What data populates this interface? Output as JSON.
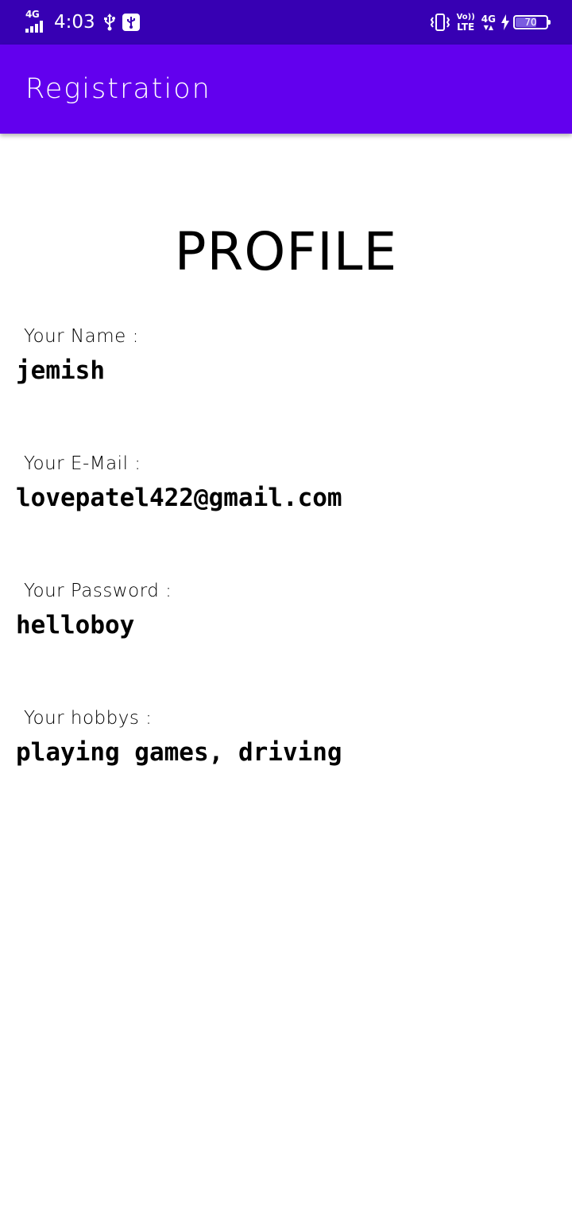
{
  "status_bar": {
    "network_label": "4G",
    "time": "4:03",
    "volte_top": "Vo))",
    "volte_bottom": "LTE",
    "data_network": "4G",
    "battery_level": "70",
    "battery_fraction": 0.7,
    "icons": [
      "signal-icon",
      "usb-icon",
      "usb-debug-icon",
      "vibrate-icon",
      "charging-icon",
      "battery-icon"
    ]
  },
  "app_bar": {
    "title": "Registration",
    "background": "#6200EE",
    "status_background": "#3700B3"
  },
  "profile": {
    "heading": "PROFILE",
    "fields": [
      {
        "label": "Your Name :",
        "value": "jemish"
      },
      {
        "label": "Your E-Mail :",
        "value": "lovepatel422@gmail.com"
      },
      {
        "label": "Your Password :",
        "value": "helloboy"
      },
      {
        "label": "Your hobbys :",
        "value": "playing games, driving"
      }
    ]
  }
}
